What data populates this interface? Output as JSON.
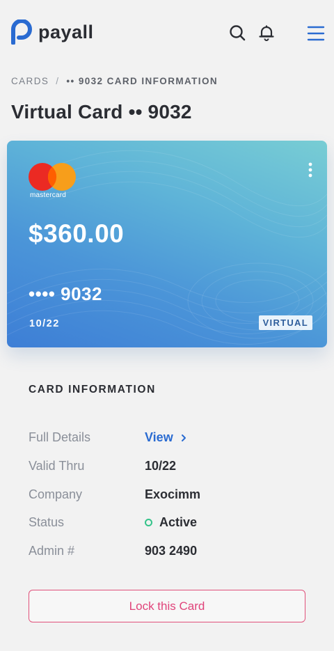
{
  "brand": {
    "name": "payall",
    "accent": "#2a6bd1"
  },
  "header": {
    "icons": [
      "search-icon",
      "bell-icon",
      "menu-icon"
    ]
  },
  "breadcrumb": {
    "root": "CARDS",
    "separator": "/",
    "current": "•• 9032 CARD INFORMATION"
  },
  "page": {
    "title": "Virtual Card •• 9032"
  },
  "card": {
    "network": "mastercard",
    "balance": "$360.00",
    "number": "•••• 9032",
    "expiry": "10/22",
    "type": "VIRTUAL",
    "gradient": [
      "#3d7ed6",
      "#78cdd4"
    ]
  },
  "info": {
    "section_title": "CARD INFORMATION",
    "rows": [
      {
        "label": "Full Details",
        "value": "View"
      },
      {
        "label": "Valid Thru",
        "value": "10/22"
      },
      {
        "label": "Company",
        "value": "Exocimm"
      },
      {
        "label": "Status",
        "value": "Active"
      },
      {
        "label": "Admin #",
        "value": "903 2490"
      }
    ],
    "status_color": "#34c38a"
  },
  "actions": {
    "lock_label": "Lock this Card",
    "lock_color": "#e0437a"
  }
}
